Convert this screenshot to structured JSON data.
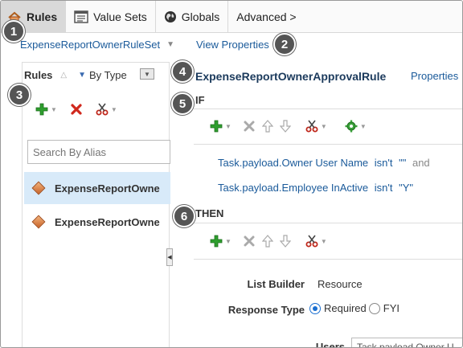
{
  "tabs": [
    {
      "label": "Rules",
      "icon": "rules-icon",
      "active": true
    },
    {
      "label": "Value Sets",
      "icon": "value-sets-icon",
      "active": false
    },
    {
      "label": "Globals",
      "icon": "globe-icon",
      "active": false
    },
    {
      "label": "Advanced >",
      "icon": "",
      "active": false
    }
  ],
  "ruleset": {
    "name": "ExpenseReportOwnerRuleSet",
    "view_properties": "View Properties"
  },
  "badges": [
    "1",
    "2",
    "3",
    "4",
    "5",
    "6"
  ],
  "left_panel": {
    "title": "Rules",
    "sort_label": "By Type",
    "search_placeholder": "Search By Alias",
    "rules": [
      {
        "label": "ExpenseReportOwne",
        "selected": true
      },
      {
        "label": "ExpenseReportOwne",
        "selected": false
      }
    ]
  },
  "rule": {
    "title": "ExpenseReportOwnerApprovalRule",
    "properties_link": "Properties",
    "if_label": "IF",
    "then_label": "THEN",
    "conditions": [
      {
        "text": "Task.payload.Owner User Name",
        "op": "isn't",
        "value": "\"\"",
        "conj": "and"
      },
      {
        "text": "Task.payload.Employee InActive",
        "op": "isn't",
        "value": "\"Y\"",
        "conj": ""
      }
    ],
    "list_builder_label": "List Builder",
    "list_builder_value": "Resource",
    "response_type_label": "Response Type",
    "response_options": [
      {
        "label": "Required",
        "selected": true
      },
      {
        "label": "FYI",
        "selected": false
      }
    ],
    "users_label": "Users",
    "users_value": "Task.payload.Owner U"
  },
  "colors": {
    "link": "#1a5a9a",
    "add_green": "#2e9e2e",
    "delete_red": "#d0281c",
    "badge": "#555555",
    "selected_row": "#d8eaf9"
  }
}
